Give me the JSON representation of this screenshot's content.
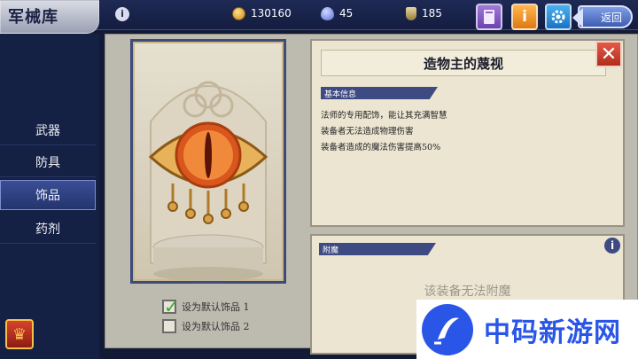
{
  "header": {
    "title": "军械库",
    "info_icon": "info-icon",
    "resources": [
      {
        "icon": "coin-icon",
        "value": "130160"
      },
      {
        "icon": "gem-icon",
        "value": "45"
      },
      {
        "icon": "shield-token-icon",
        "value": "185"
      }
    ],
    "buttons": {
      "book_icon": "book-icon",
      "info_label": "i",
      "gear_icon": "gear-icon",
      "back_label": "返回"
    }
  },
  "sidebar": {
    "items": [
      {
        "label": "武器",
        "active": false
      },
      {
        "label": "防具",
        "active": false
      },
      {
        "label": "饰品",
        "active": true
      },
      {
        "label": "药剂",
        "active": false
      }
    ],
    "trophy_icon": "trophy-icon"
  },
  "item": {
    "name": "造物主的蔑视",
    "section_basic": "基本信息",
    "descriptions": [
      "法师的专用配饰，能让其充满智慧",
      "装备者无法造成物理伤害",
      "装备者造成的魔法伤害提高50%"
    ],
    "section_enchant": "附魔",
    "enchant_text": "该装备无法附魔"
  },
  "options": [
    {
      "label": "设为默认饰品 1",
      "checked": true
    },
    {
      "label": "设为默认饰品 2",
      "checked": false
    }
  ],
  "watermark": {
    "text": "中码新游网"
  },
  "colors": {
    "accent_blue": "#3e4a82",
    "close_red": "#c83a28",
    "eye_orange": "#e0621e",
    "gold": "#c8891c"
  }
}
